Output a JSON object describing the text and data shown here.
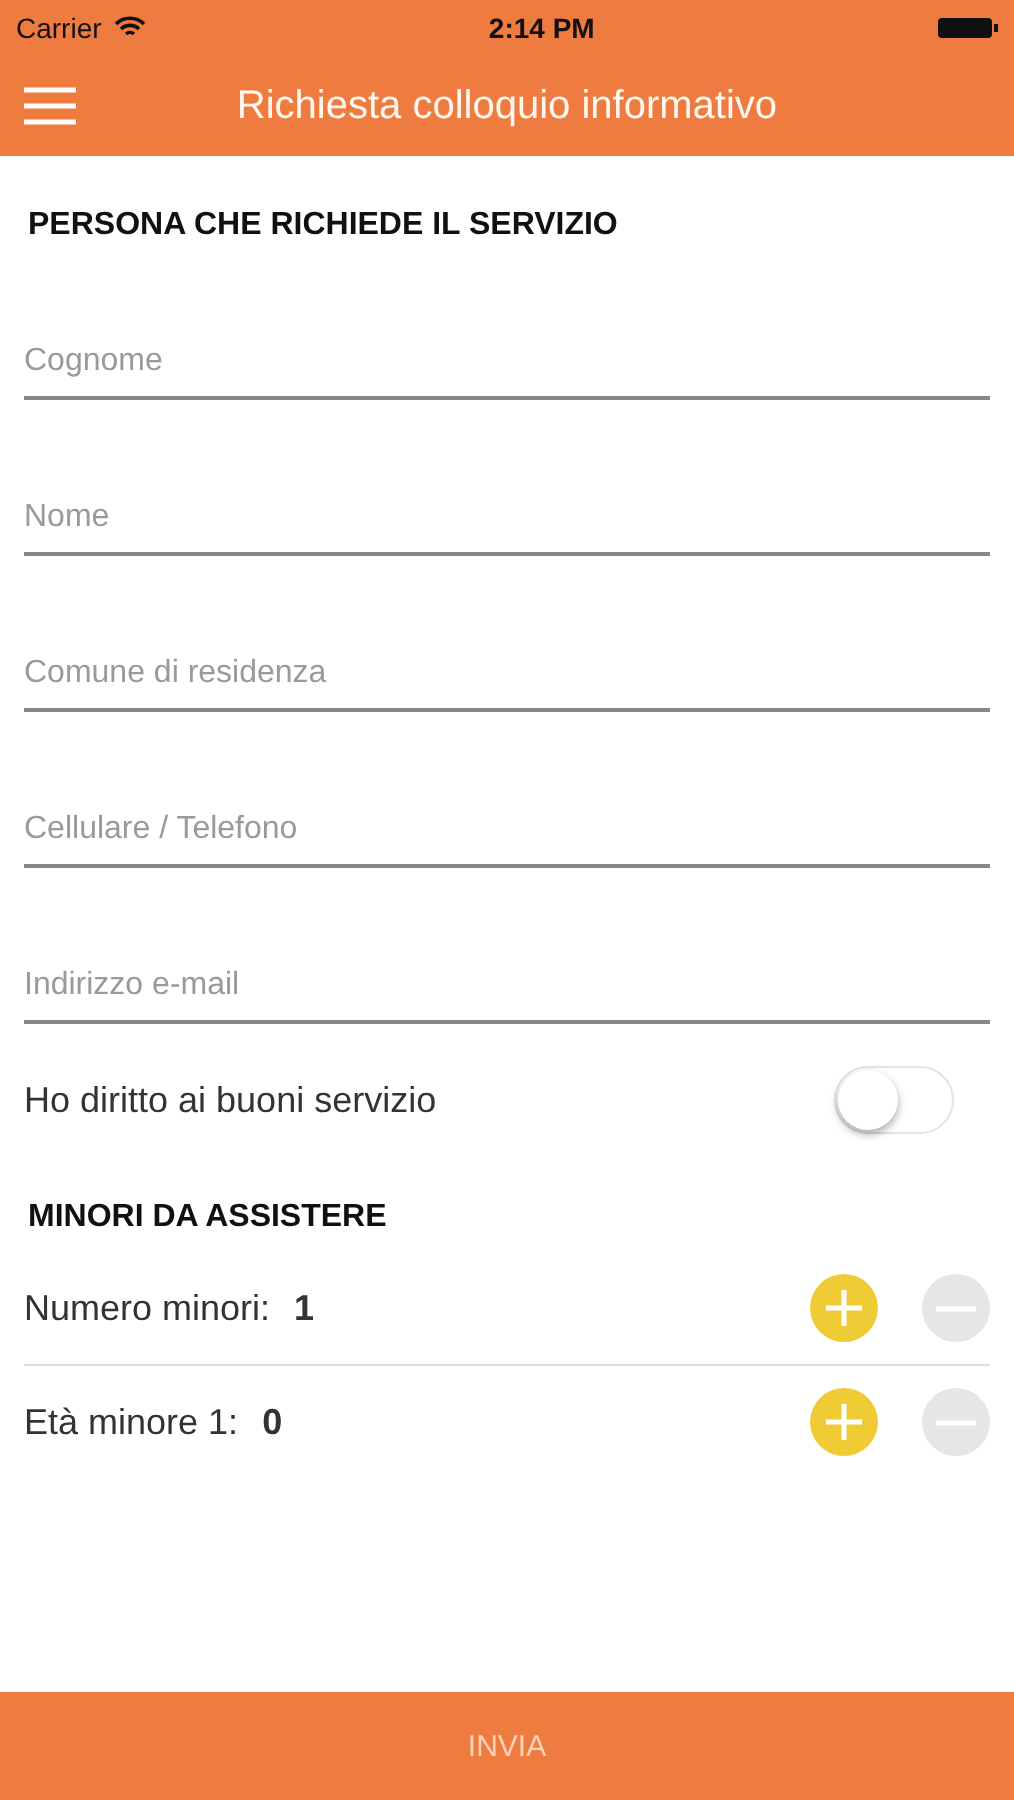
{
  "status_bar": {
    "carrier": "Carrier",
    "time": "2:14 PM"
  },
  "nav_bar": {
    "title": "Richiesta colloquio informativo"
  },
  "sections": [
    {
      "title": "PERSONA CHE RICHIEDE IL SERVIZIO",
      "fields": [
        {
          "placeholder": "Cognome"
        },
        {
          "placeholder": "Nome"
        },
        {
          "placeholder": "Comune di residenza"
        },
        {
          "placeholder": "Cellulare / Telefono"
        },
        {
          "placeholder": "Indirizzo e-mail"
        }
      ],
      "toggle": {
        "label": "Ho diritto ai buoni servizio",
        "on": false
      }
    },
    {
      "title": "MINORI DA ASSISTERE",
      "steppers": [
        {
          "label": "Numero minori:",
          "value": "1",
          "plus_disabled": false,
          "minus_disabled": true
        },
        {
          "label": "Età minore 1:",
          "value": "0",
          "plus_disabled": false,
          "minus_disabled": true
        }
      ]
    }
  ],
  "submit": {
    "label": "INVIA",
    "disabled": true
  }
}
